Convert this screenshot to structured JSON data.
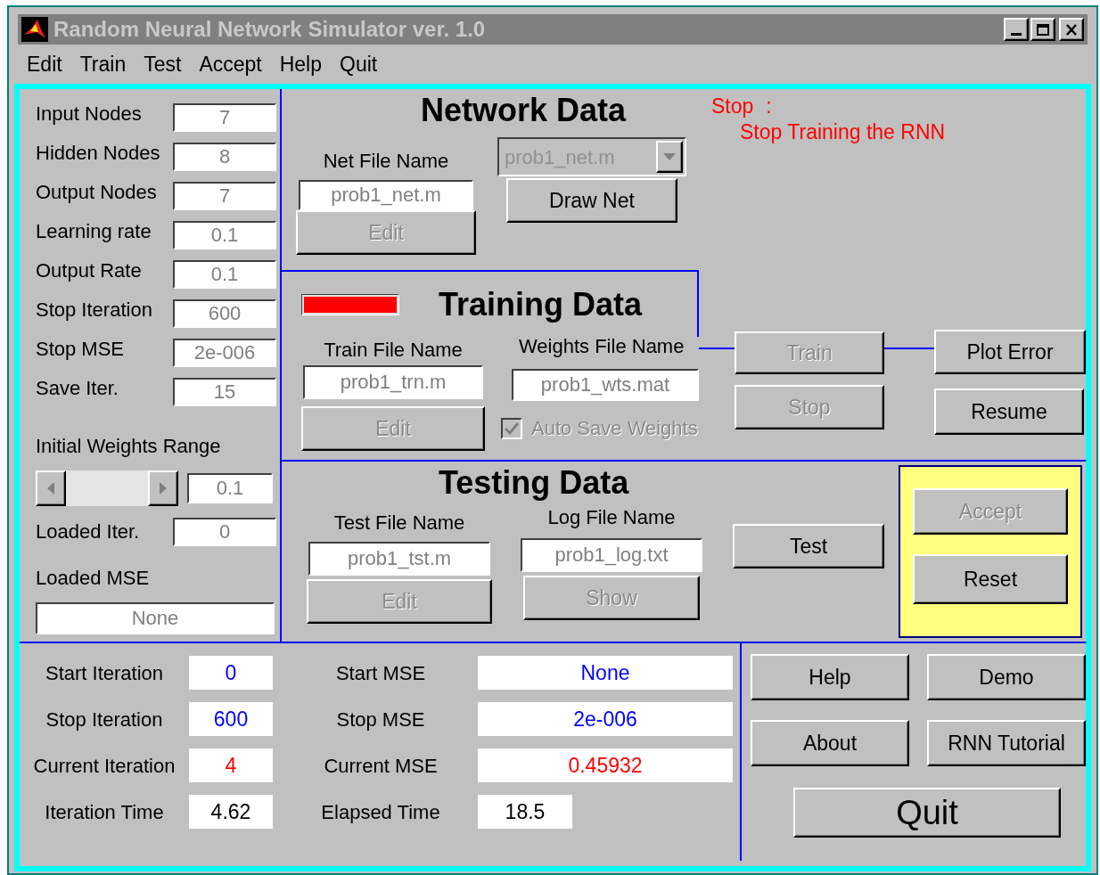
{
  "window": {
    "title": "Random Neural Network Simulator ver. 1.0"
  },
  "menu": [
    "Edit",
    "Train",
    "Test",
    "Accept",
    "Help",
    "Quit"
  ],
  "parameters": [
    {
      "label": "Input Nodes",
      "value": "7"
    },
    {
      "label": "Hidden Nodes",
      "value": "8"
    },
    {
      "label": "Output Nodes",
      "value": "7"
    },
    {
      "label": "Learning rate",
      "value": "0.1"
    },
    {
      "label": "Output Rate",
      "value": "0.1"
    },
    {
      "label": "Stop Iteration",
      "value": "600"
    },
    {
      "label": "Stop MSE",
      "value": "2e-006"
    },
    {
      "label": "Save Iter.",
      "value": "15"
    }
  ],
  "initial_weights": {
    "label": "Initial Weights Range",
    "value": "0.1"
  },
  "loaded_iter": {
    "label": "Loaded Iter.",
    "value": "0"
  },
  "loaded_mse": {
    "label": "Loaded MSE",
    "value": "None"
  },
  "network": {
    "title": "Network Data",
    "net_file": {
      "label": "Net File Name",
      "value": "prob1_net.m"
    },
    "dropdown": {
      "value": "prob1_net.m",
      "disabled": true
    },
    "edit_button": {
      "label": "Edit",
      "disabled": true
    },
    "draw_button": {
      "label": "Draw Net",
      "disabled": false
    }
  },
  "hint": {
    "key": "Stop",
    "separator": ":",
    "text": "Stop Training the RNN"
  },
  "training": {
    "title": "Training Data",
    "progress": {
      "level": 1
    },
    "train_file": {
      "label": "Train File Name",
      "value": "prob1_trn.m"
    },
    "weights_file": {
      "label": "Weights File Name",
      "value": "prob1_wts.mat"
    },
    "edit_button": {
      "label": "Edit",
      "disabled": true
    },
    "auto_save": {
      "label": "Auto Save Weights",
      "checked": true,
      "disabled": true
    },
    "train_button": {
      "label": "Train",
      "disabled": true
    },
    "stop_button": {
      "label": "Stop",
      "disabled": true
    },
    "plot_button": {
      "label": "Plot Error",
      "disabled": false
    },
    "resume_button": {
      "label": "Resume",
      "disabled": false
    }
  },
  "testing": {
    "title": "Testing Data",
    "test_file": {
      "label": "Test File Name",
      "value": "prob1_tst.m"
    },
    "log_file": {
      "label": "Log File Name",
      "value": "prob1_log.txt"
    },
    "edit_button": {
      "label": "Edit",
      "disabled": true
    },
    "show_button": {
      "label": "Show",
      "disabled": true
    },
    "test_button": {
      "label": "Test",
      "disabled": false
    }
  },
  "decision": {
    "accept_button": {
      "label": "Accept",
      "disabled": true
    },
    "reset_button": {
      "label": "Reset",
      "disabled": false
    }
  },
  "status_iterations": [
    {
      "label": "Start Iteration",
      "value": "0",
      "color": "#0000ff"
    },
    {
      "label": "Stop Iteration",
      "value": "600",
      "color": "#0000ff"
    },
    {
      "label": "Current Iteration",
      "value": "4",
      "color": "#ff0000"
    },
    {
      "label": "Iteration Time",
      "value": "4.62",
      "color": "#000000"
    }
  ],
  "status_mse": [
    {
      "label": "Start MSE",
      "value": "None",
      "color": "#0000ff"
    },
    {
      "label": "Stop MSE",
      "value": "2e-006",
      "color": "#0000ff"
    },
    {
      "label": "Current MSE",
      "value": "0.45932",
      "color": "#ff0000"
    },
    {
      "label": "Elapsed Time",
      "value": "18.5",
      "color": "#000000"
    }
  ],
  "actions": [
    {
      "label": "Help"
    },
    {
      "label": "Demo"
    },
    {
      "label": "About"
    },
    {
      "label": "RNN Tutorial"
    }
  ],
  "quit_button": {
    "label": "Quit"
  }
}
